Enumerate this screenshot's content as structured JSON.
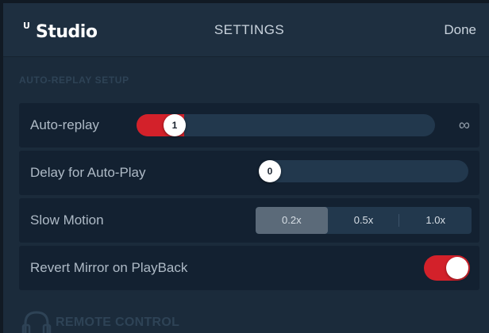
{
  "header": {
    "logo_mark": "U",
    "logo_text": "Studio",
    "title": "SETTINGS",
    "done_label": "Done"
  },
  "section": {
    "title": "AUTO-REPLAY SETUP"
  },
  "rows": {
    "auto_replay": {
      "label": "Auto-replay",
      "value": "1",
      "max_symbol": "∞"
    },
    "delay": {
      "label": "Delay for Auto-Play",
      "value": "0"
    },
    "slow_motion": {
      "label": "Slow Motion",
      "options": [
        "0.2x",
        "0.5x",
        "1.0x"
      ],
      "selected": "0.2x"
    },
    "revert_mirror": {
      "label": "Revert Mirror on PlayBack",
      "enabled": true
    }
  },
  "remote": {
    "label": "REMOTE CONTROL",
    "icon": "headphones-icon"
  },
  "colors": {
    "accent": "#d3212a",
    "panel": "#1b2b3b",
    "row": "#132131",
    "track": "#22384d"
  }
}
